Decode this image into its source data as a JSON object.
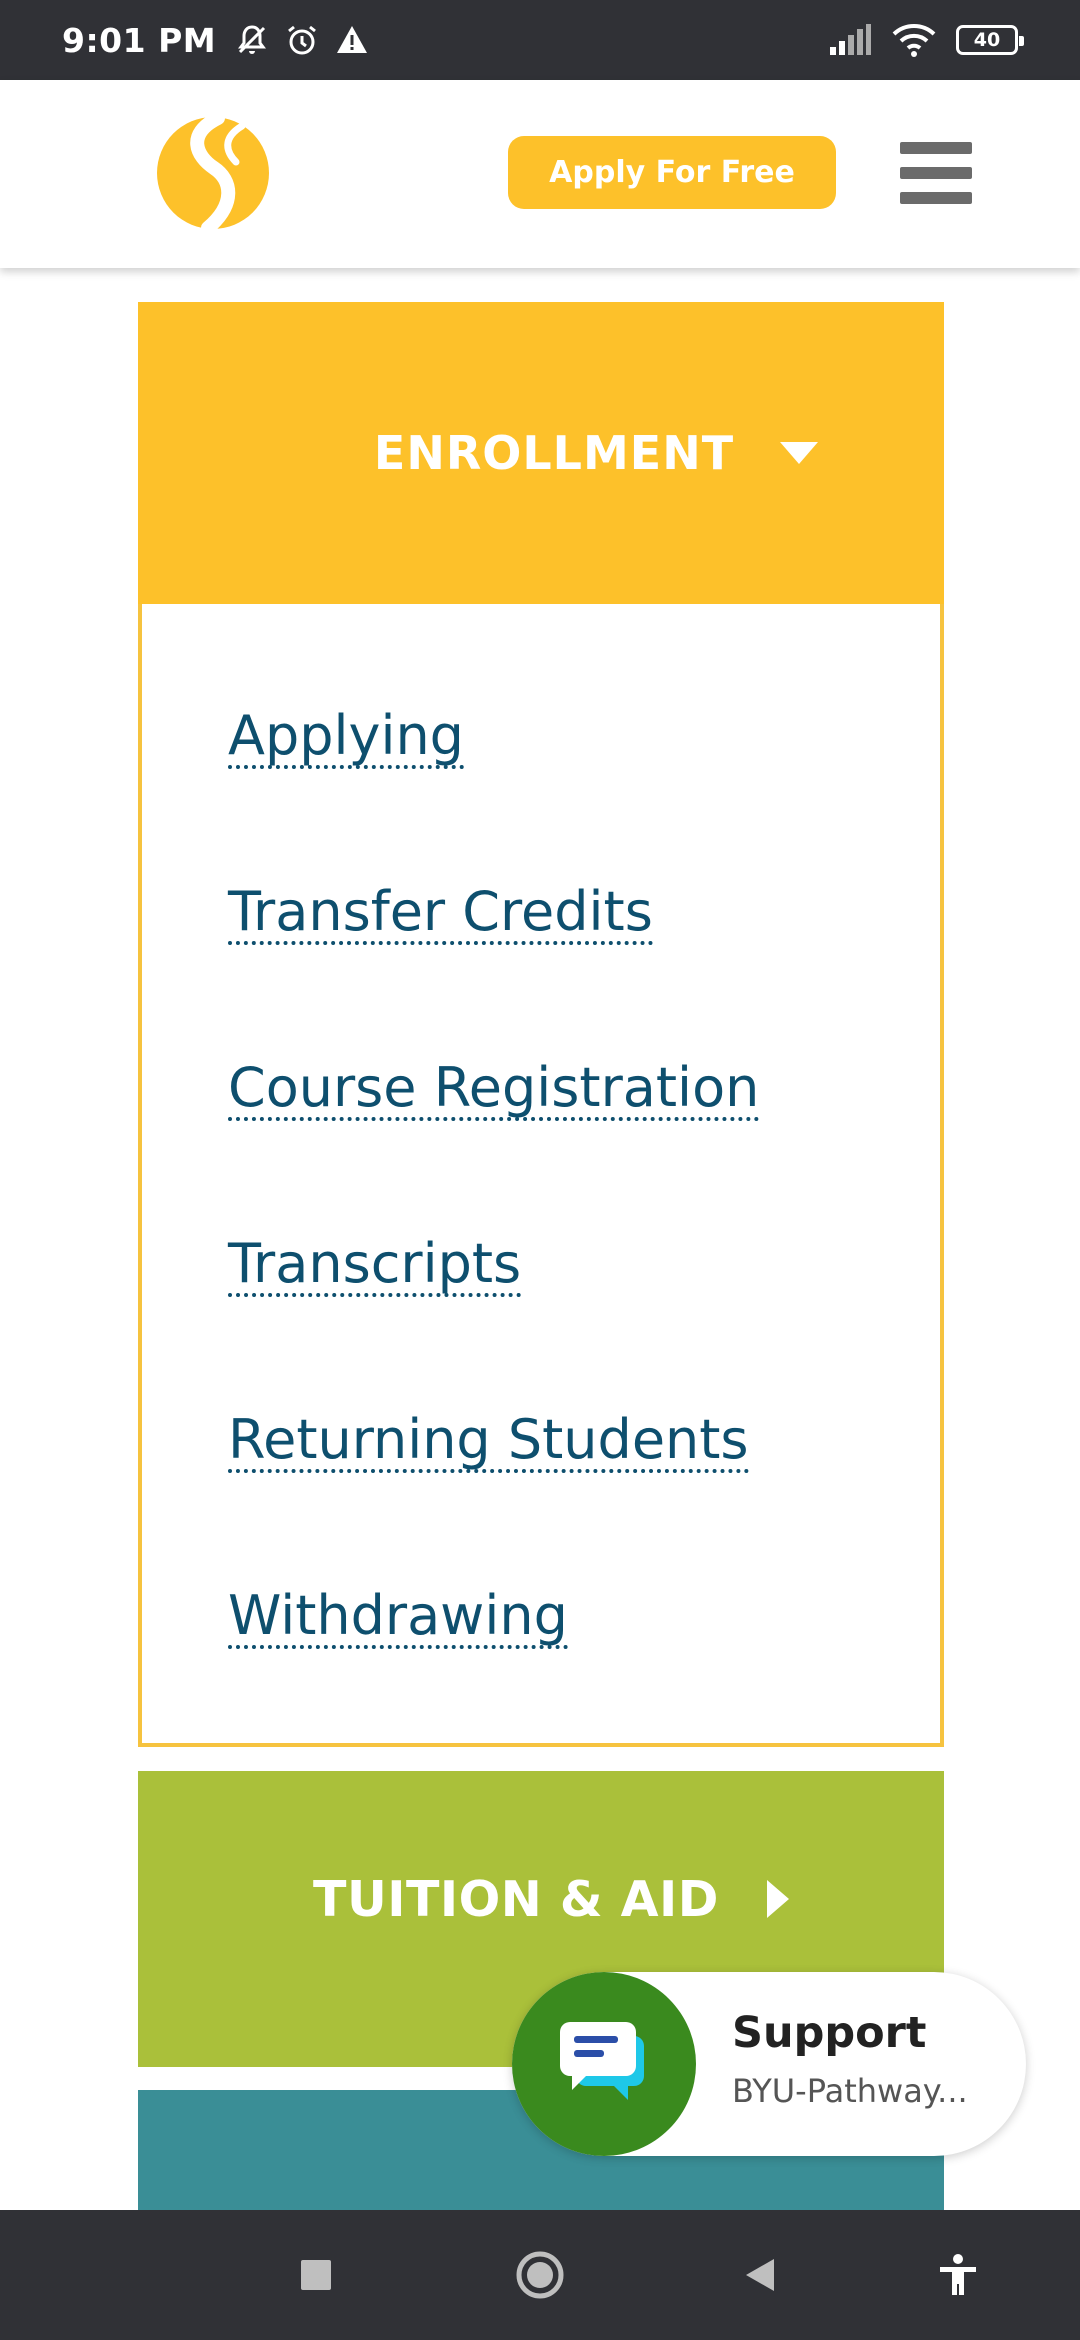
{
  "status_bar": {
    "time": "9:01 PM",
    "battery": "40",
    "icons": [
      "notifications-off-icon",
      "alarm-icon",
      "warning-icon",
      "signal-icon",
      "wifi-icon",
      "battery-icon"
    ]
  },
  "header": {
    "logo": "byu-pathway-logo",
    "apply_label": "Apply For Free",
    "menu_icon": "hamburger-menu-icon",
    "colors": {
      "accent": "#FDC12A"
    }
  },
  "enrollment": {
    "title": "ENROLLMENT",
    "expanded": true,
    "links": [
      {
        "label": "Applying"
      },
      {
        "label": "Transfer Credits"
      },
      {
        "label": "Course Registration"
      },
      {
        "label": "Transcripts"
      },
      {
        "label": "Returning Students"
      },
      {
        "label": "Withdrawing"
      }
    ],
    "colors": {
      "header": "#FDC12A",
      "link": "#0E4F6E"
    }
  },
  "tuition": {
    "title": "TUITION & AID",
    "expanded": false,
    "color": "#AAC03A"
  },
  "next_section_color": "#3A8E96",
  "support_widget": {
    "title": "Support",
    "subtitle": "BYU-Pathway...",
    "icon": "chat-bubbles-icon",
    "color": "#3A8A1E"
  },
  "nav_bar": {
    "buttons": [
      "recents-square-icon",
      "home-circle-icon",
      "back-triangle-icon",
      "accessibility-icon"
    ]
  }
}
